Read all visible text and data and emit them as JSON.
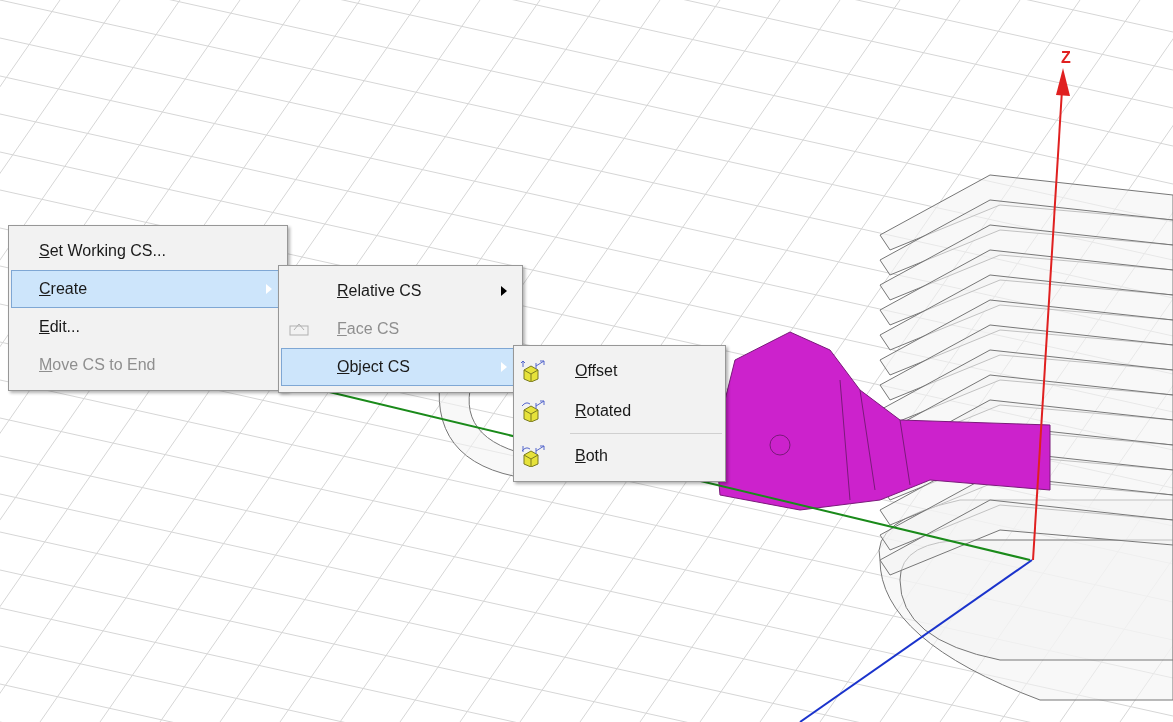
{
  "viewport": {
    "axis_label": "Z"
  },
  "menus": [
    {
      "items": [
        {
          "kind": "item",
          "label": "Set Working CS...",
          "selected": false,
          "disabled": false,
          "submenu": false,
          "icon": false
        },
        {
          "kind": "item",
          "label": "Create",
          "selected": true,
          "disabled": false,
          "submenu": true,
          "icon": false
        },
        {
          "kind": "item",
          "label": "Edit...",
          "selected": false,
          "disabled": false,
          "submenu": false,
          "icon": false
        },
        {
          "kind": "item",
          "label": "Move CS to End",
          "selected": false,
          "disabled": true,
          "submenu": false,
          "icon": false
        }
      ]
    },
    {
      "items": [
        {
          "kind": "item",
          "label": "Relative CS",
          "selected": false,
          "disabled": false,
          "submenu": true,
          "icon": false
        },
        {
          "kind": "item",
          "label": "Face CS",
          "selected": false,
          "disabled": true,
          "submenu": false,
          "icon": true
        },
        {
          "kind": "item",
          "label": "Object CS",
          "selected": true,
          "disabled": false,
          "submenu": true,
          "icon": false
        }
      ]
    },
    {
      "items": [
        {
          "kind": "item",
          "label": "Offset",
          "selected": false,
          "disabled": false,
          "submenu": false,
          "icon": true
        },
        {
          "kind": "item",
          "label": "Rotated",
          "selected": false,
          "disabled": false,
          "submenu": false,
          "icon": true
        },
        {
          "kind": "separator"
        },
        {
          "kind": "item",
          "label": "Both",
          "selected": false,
          "disabled": false,
          "submenu": false,
          "icon": true
        }
      ]
    }
  ]
}
